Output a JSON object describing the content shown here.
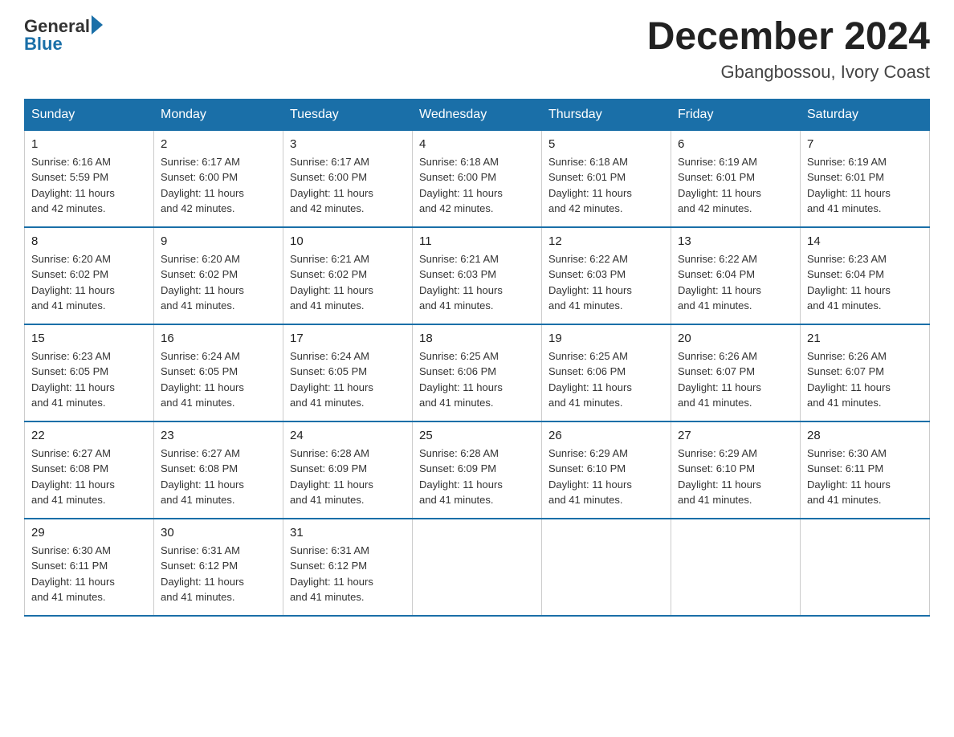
{
  "header": {
    "logo_general": "General",
    "logo_blue": "Blue",
    "month_title": "December 2024",
    "location": "Gbangbossou, Ivory Coast"
  },
  "days_of_week": [
    "Sunday",
    "Monday",
    "Tuesday",
    "Wednesday",
    "Thursday",
    "Friday",
    "Saturday"
  ],
  "weeks": [
    [
      {
        "day": "1",
        "sunrise": "6:16 AM",
        "sunset": "5:59 PM",
        "daylight": "11 hours and 42 minutes."
      },
      {
        "day": "2",
        "sunrise": "6:17 AM",
        "sunset": "6:00 PM",
        "daylight": "11 hours and 42 minutes."
      },
      {
        "day": "3",
        "sunrise": "6:17 AM",
        "sunset": "6:00 PM",
        "daylight": "11 hours and 42 minutes."
      },
      {
        "day": "4",
        "sunrise": "6:18 AM",
        "sunset": "6:00 PM",
        "daylight": "11 hours and 42 minutes."
      },
      {
        "day": "5",
        "sunrise": "6:18 AM",
        "sunset": "6:01 PM",
        "daylight": "11 hours and 42 minutes."
      },
      {
        "day": "6",
        "sunrise": "6:19 AM",
        "sunset": "6:01 PM",
        "daylight": "11 hours and 42 minutes."
      },
      {
        "day": "7",
        "sunrise": "6:19 AM",
        "sunset": "6:01 PM",
        "daylight": "11 hours and 41 minutes."
      }
    ],
    [
      {
        "day": "8",
        "sunrise": "6:20 AM",
        "sunset": "6:02 PM",
        "daylight": "11 hours and 41 minutes."
      },
      {
        "day": "9",
        "sunrise": "6:20 AM",
        "sunset": "6:02 PM",
        "daylight": "11 hours and 41 minutes."
      },
      {
        "day": "10",
        "sunrise": "6:21 AM",
        "sunset": "6:02 PM",
        "daylight": "11 hours and 41 minutes."
      },
      {
        "day": "11",
        "sunrise": "6:21 AM",
        "sunset": "6:03 PM",
        "daylight": "11 hours and 41 minutes."
      },
      {
        "day": "12",
        "sunrise": "6:22 AM",
        "sunset": "6:03 PM",
        "daylight": "11 hours and 41 minutes."
      },
      {
        "day": "13",
        "sunrise": "6:22 AM",
        "sunset": "6:04 PM",
        "daylight": "11 hours and 41 minutes."
      },
      {
        "day": "14",
        "sunrise": "6:23 AM",
        "sunset": "6:04 PM",
        "daylight": "11 hours and 41 minutes."
      }
    ],
    [
      {
        "day": "15",
        "sunrise": "6:23 AM",
        "sunset": "6:05 PM",
        "daylight": "11 hours and 41 minutes."
      },
      {
        "day": "16",
        "sunrise": "6:24 AM",
        "sunset": "6:05 PM",
        "daylight": "11 hours and 41 minutes."
      },
      {
        "day": "17",
        "sunrise": "6:24 AM",
        "sunset": "6:05 PM",
        "daylight": "11 hours and 41 minutes."
      },
      {
        "day": "18",
        "sunrise": "6:25 AM",
        "sunset": "6:06 PM",
        "daylight": "11 hours and 41 minutes."
      },
      {
        "day": "19",
        "sunrise": "6:25 AM",
        "sunset": "6:06 PM",
        "daylight": "11 hours and 41 minutes."
      },
      {
        "day": "20",
        "sunrise": "6:26 AM",
        "sunset": "6:07 PM",
        "daylight": "11 hours and 41 minutes."
      },
      {
        "day": "21",
        "sunrise": "6:26 AM",
        "sunset": "6:07 PM",
        "daylight": "11 hours and 41 minutes."
      }
    ],
    [
      {
        "day": "22",
        "sunrise": "6:27 AM",
        "sunset": "6:08 PM",
        "daylight": "11 hours and 41 minutes."
      },
      {
        "day": "23",
        "sunrise": "6:27 AM",
        "sunset": "6:08 PM",
        "daylight": "11 hours and 41 minutes."
      },
      {
        "day": "24",
        "sunrise": "6:28 AM",
        "sunset": "6:09 PM",
        "daylight": "11 hours and 41 minutes."
      },
      {
        "day": "25",
        "sunrise": "6:28 AM",
        "sunset": "6:09 PM",
        "daylight": "11 hours and 41 minutes."
      },
      {
        "day": "26",
        "sunrise": "6:29 AM",
        "sunset": "6:10 PM",
        "daylight": "11 hours and 41 minutes."
      },
      {
        "day": "27",
        "sunrise": "6:29 AM",
        "sunset": "6:10 PM",
        "daylight": "11 hours and 41 minutes."
      },
      {
        "day": "28",
        "sunrise": "6:30 AM",
        "sunset": "6:11 PM",
        "daylight": "11 hours and 41 minutes."
      }
    ],
    [
      {
        "day": "29",
        "sunrise": "6:30 AM",
        "sunset": "6:11 PM",
        "daylight": "11 hours and 41 minutes."
      },
      {
        "day": "30",
        "sunrise": "6:31 AM",
        "sunset": "6:12 PM",
        "daylight": "11 hours and 41 minutes."
      },
      {
        "day": "31",
        "sunrise": "6:31 AM",
        "sunset": "6:12 PM",
        "daylight": "11 hours and 41 minutes."
      },
      null,
      null,
      null,
      null
    ]
  ],
  "labels": {
    "sunrise": "Sunrise:",
    "sunset": "Sunset:",
    "daylight": "Daylight:"
  }
}
